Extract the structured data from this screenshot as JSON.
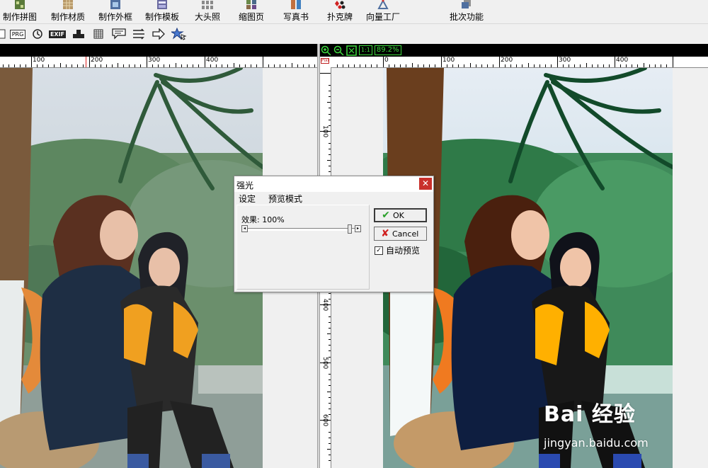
{
  "menu": {
    "items": [
      {
        "label": "制作拼图"
      },
      {
        "label": "制作材质"
      },
      {
        "label": "制作外框"
      },
      {
        "label": "制作模板"
      },
      {
        "label": "大头照"
      },
      {
        "label": "缩图页"
      },
      {
        "label": "写真书"
      },
      {
        "label": "扑克牌"
      },
      {
        "label": "向量工厂"
      },
      {
        "label": "批次功能"
      }
    ]
  },
  "toolbar2": {
    "prg_label": "PRG",
    "exif_label": "EXIF"
  },
  "left_ruler": {
    "top_ticks": [
      "100",
      "200",
      "300",
      "400"
    ]
  },
  "right_ruler": {
    "top_ticks": [
      "0",
      "100",
      "200",
      "300",
      "400"
    ],
    "side_ticks": [
      "100",
      "200",
      "300",
      "400",
      "500",
      "600"
    ],
    "corner_label": "Pixl"
  },
  "zoom": {
    "fit_label": "1:1",
    "percent": "89.2%"
  },
  "dialog": {
    "title": "强光",
    "tabs": [
      "设定",
      "预览模式"
    ],
    "effect_label": "效果: 100%",
    "effect_value": 100,
    "ok_label": "OK",
    "cancel_label": "Cancel",
    "auto_preview_label": "自动预览",
    "auto_preview_checked": true
  },
  "watermark": {
    "brand": "Bai 经验",
    "url": "jingyan.baidu.com"
  },
  "colors": {
    "zoom_green": "#3fdc3f",
    "close_red": "#c9302c"
  }
}
